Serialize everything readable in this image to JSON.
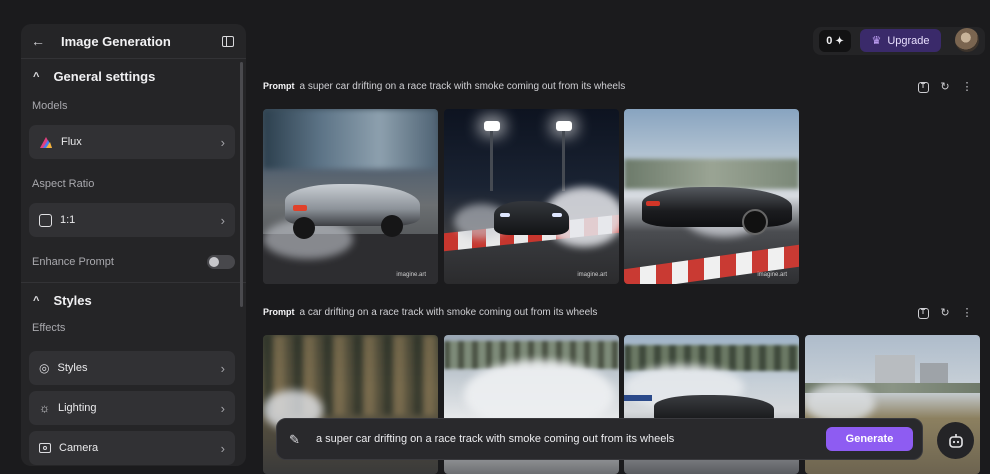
{
  "sidebar": {
    "title": "Image Generation",
    "general_settings": "General settings",
    "models_label": "Models",
    "model_value": "Flux",
    "aspect_label": "Aspect Ratio",
    "aspect_value": "1:1",
    "enhance_label": "Enhance Prompt",
    "enhance_enabled": false,
    "styles_header": "Styles",
    "effects_label": "Effects",
    "effects": [
      {
        "label": "Styles",
        "icon": "palette-icon"
      },
      {
        "label": "Lighting",
        "icon": "sun-icon"
      },
      {
        "label": "Camera",
        "icon": "camera-icon"
      }
    ]
  },
  "topbar": {
    "credits": "0",
    "upgrade_label": "Upgrade"
  },
  "feed": [
    {
      "prompt_tag": "Prompt",
      "prompt": "a super car drifting on a race track with smoke coming out from its wheels"
    },
    {
      "prompt_tag": "Prompt",
      "prompt": "a car drifting on a race track with smoke coming out from its wheels"
    }
  ],
  "watermark": "imagine.art",
  "input": {
    "value": "a super car drifting on a race track with smoke coming out from its wheels",
    "generate_label": "Generate"
  },
  "colors": {
    "accent": "#8e5cf2",
    "background": "#1b1b1d",
    "panel": "#252527"
  }
}
